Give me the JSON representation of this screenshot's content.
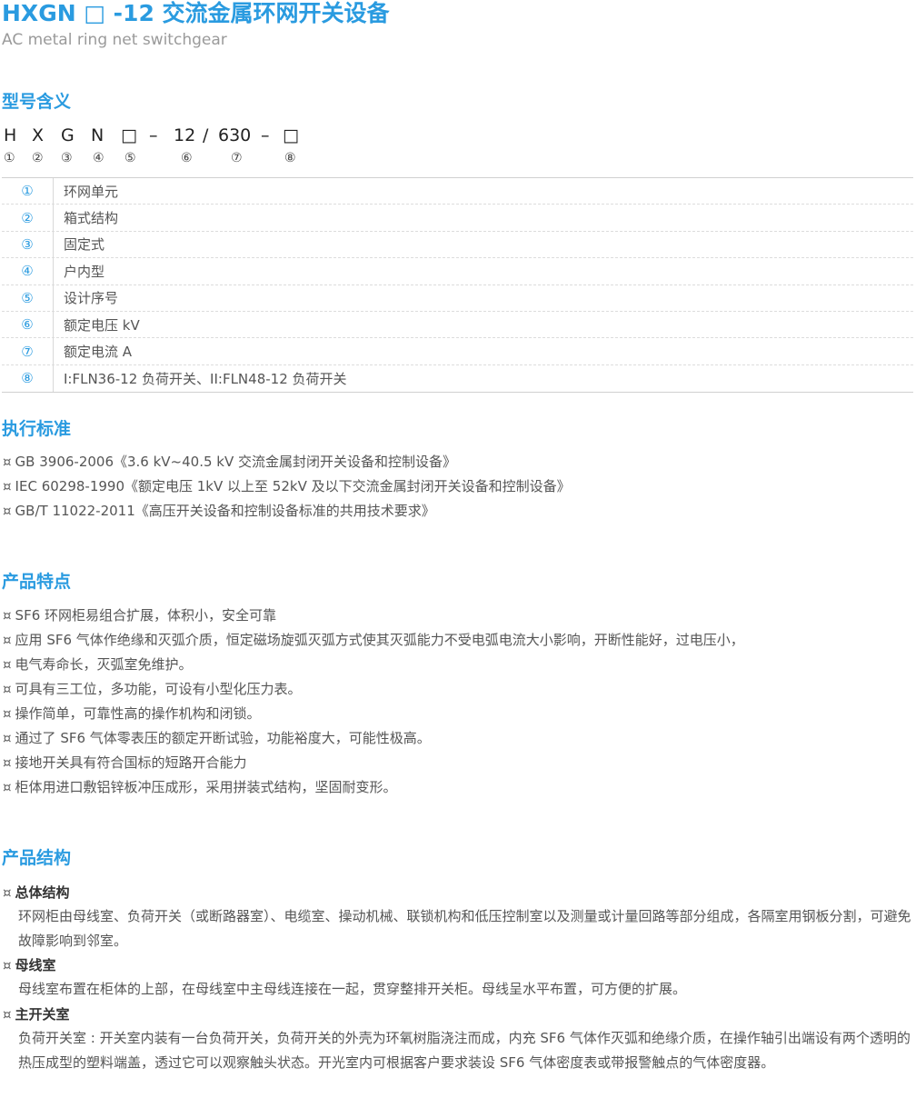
{
  "header": {
    "title": "HXGN □ -12 交流金属环网开关设备",
    "subtitle": "AC metal ring net switchgear"
  },
  "model": {
    "section_title": "型号含义",
    "code_parts": [
      "H",
      "X",
      "G",
      "N",
      "□",
      "–",
      "12",
      "/",
      "630",
      "–",
      "□"
    ],
    "markers": [
      "①",
      "②",
      "③",
      "④",
      "⑤",
      "⑥",
      "⑦",
      "⑧"
    ],
    "rows": [
      {
        "num": "①",
        "text": "环网单元"
      },
      {
        "num": "②",
        "text": "箱式结构"
      },
      {
        "num": "③",
        "text": "固定式"
      },
      {
        "num": "④",
        "text": "户内型"
      },
      {
        "num": "⑤",
        "text": "设计序号"
      },
      {
        "num": "⑥",
        "text": "额定电压 kV"
      },
      {
        "num": "⑦",
        "text": "额定电流 A"
      },
      {
        "num": "⑧",
        "text": "I:FLN36-12 负荷开关、II:FLN48-12 负荷开关"
      }
    ]
  },
  "standards": {
    "section_title": "执行标准",
    "bullet": "¤",
    "items": [
      "GB 3906-2006《3.6 kV~40.5 kV 交流金属封闭开关设备和控制设备》",
      "IEC 60298-1990《额定电压 1kV 以上至 52kV 及以下交流金属封闭开关设备和控制设备》",
      "GB/T 11022-2011《高压开关设备和控制设备标准的共用技术要求》"
    ]
  },
  "features": {
    "section_title": "产品特点",
    "bullet": "¤",
    "items": [
      "SF6 环网柜易组合扩展，体积小，安全可靠",
      "应用 SF6 气体作绝缘和灭弧介质，恒定磁场旋弧灭弧方式使其灭弧能力不受电弧电流大小影响，开断性能好，过电压小，",
      "电气寿命长，灭弧室免维护。",
      "可具有三工位，多功能，可设有小型化压力表。",
      "操作简单，可靠性高的操作机构和闭锁。",
      "通过了 SF6 气体零表压的额定开断试验，功能裕度大，可能性极高。",
      "接地开关具有符合国标的短路开合能力",
      "柜体用进口敷铝锌板冲压成形，采用拼装式结构，坚固耐变形。"
    ]
  },
  "structure": {
    "section_title": "产品结构",
    "bullet": "¤",
    "items": [
      {
        "heading": "总体结构",
        "text": "环网柜由母线室、负荷开关（或断路器室）、电缆室、操动机械、联锁机构和低压控制室以及测量或计量回路等部分组成，各隔室用钢板分割，可避免故障影响到邻室。"
      },
      {
        "heading": "母线室",
        "text": "母线室布置在柜体的上部，在母线室中主母线连接在一起，贯穿整排开关柜。母线呈水平布置，可方便的扩展。"
      },
      {
        "heading": "主开关室",
        "text": "负荷开关室 : 开关室内装有一台负荷开关，负荷开关的外壳为环氧树脂浇注而成，内充 SF6 气体作灭弧和绝缘介质，在操作轴引出端设有两个透明的热压成型的塑料端盖，透过它可以观察触头状态。开光室内可根据客户要求装设 SF6 气体密度表或带报警触点的气体密度器。"
      }
    ]
  }
}
